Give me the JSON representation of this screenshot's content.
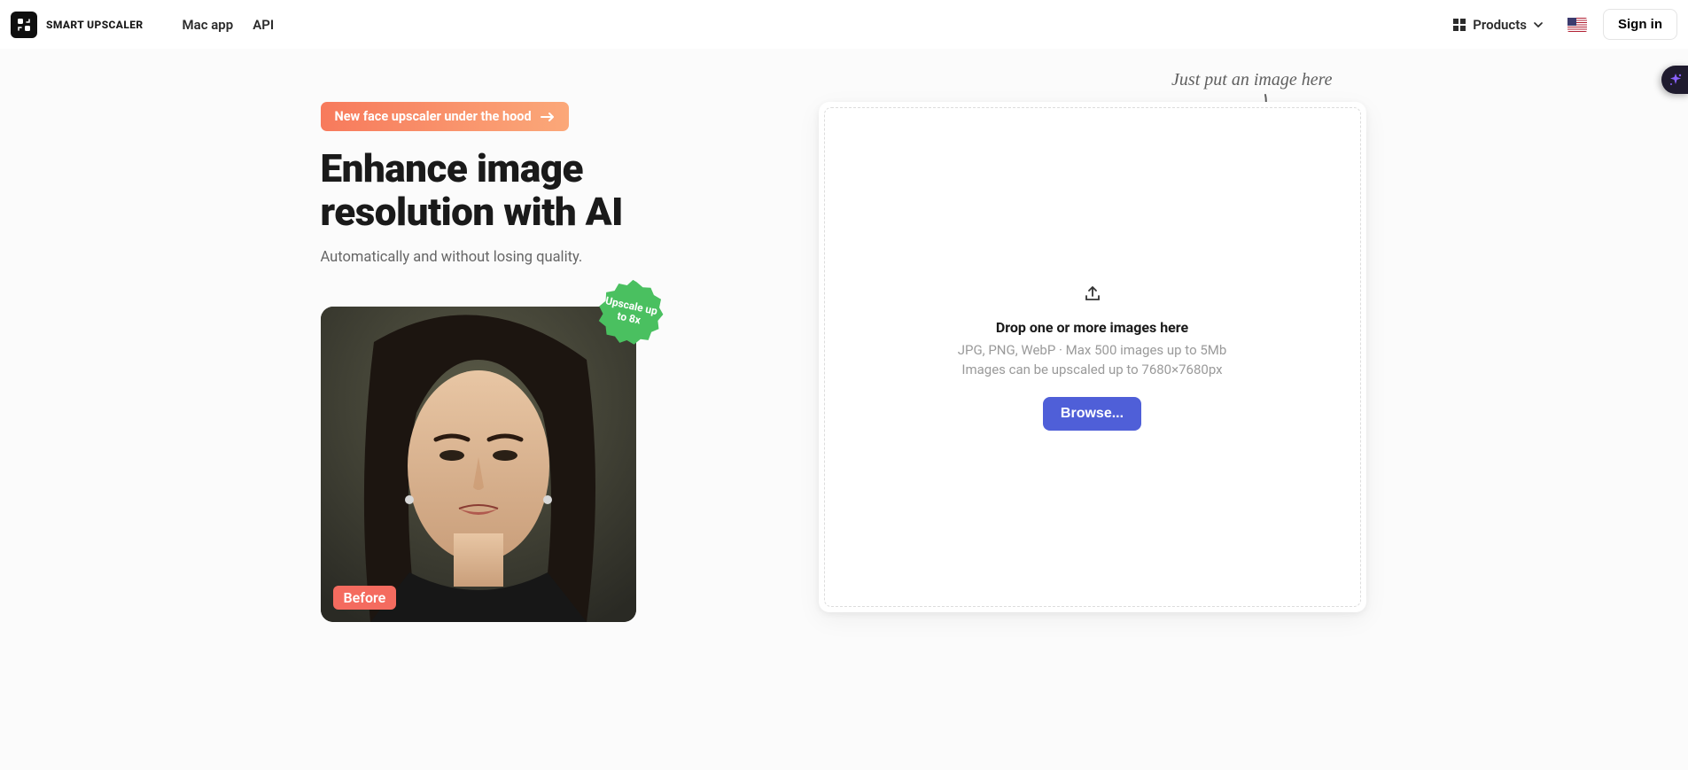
{
  "header": {
    "brand_name": "SMART UPSCALER",
    "nav": {
      "mac_app": "Mac app",
      "api": "API"
    },
    "products_label": "Products",
    "signin_label": "Sign in"
  },
  "promo": {
    "label": "New face upscaler under the hood"
  },
  "hero": {
    "title": "Enhance image resolution with AI",
    "subtitle": "Automatically and without losing quality."
  },
  "demo": {
    "before_label": "Before",
    "badge_text": "Upscale up to 8x"
  },
  "dropzone": {
    "hint_text": "Just put an image here",
    "title": "Drop one or more images here",
    "meta_line1": "JPG, PNG, WebP · Max 500 images up to 5Mb",
    "meta_line2": "Images can be upscaled up to 7680×7680px",
    "browse_label": "Browse..."
  }
}
